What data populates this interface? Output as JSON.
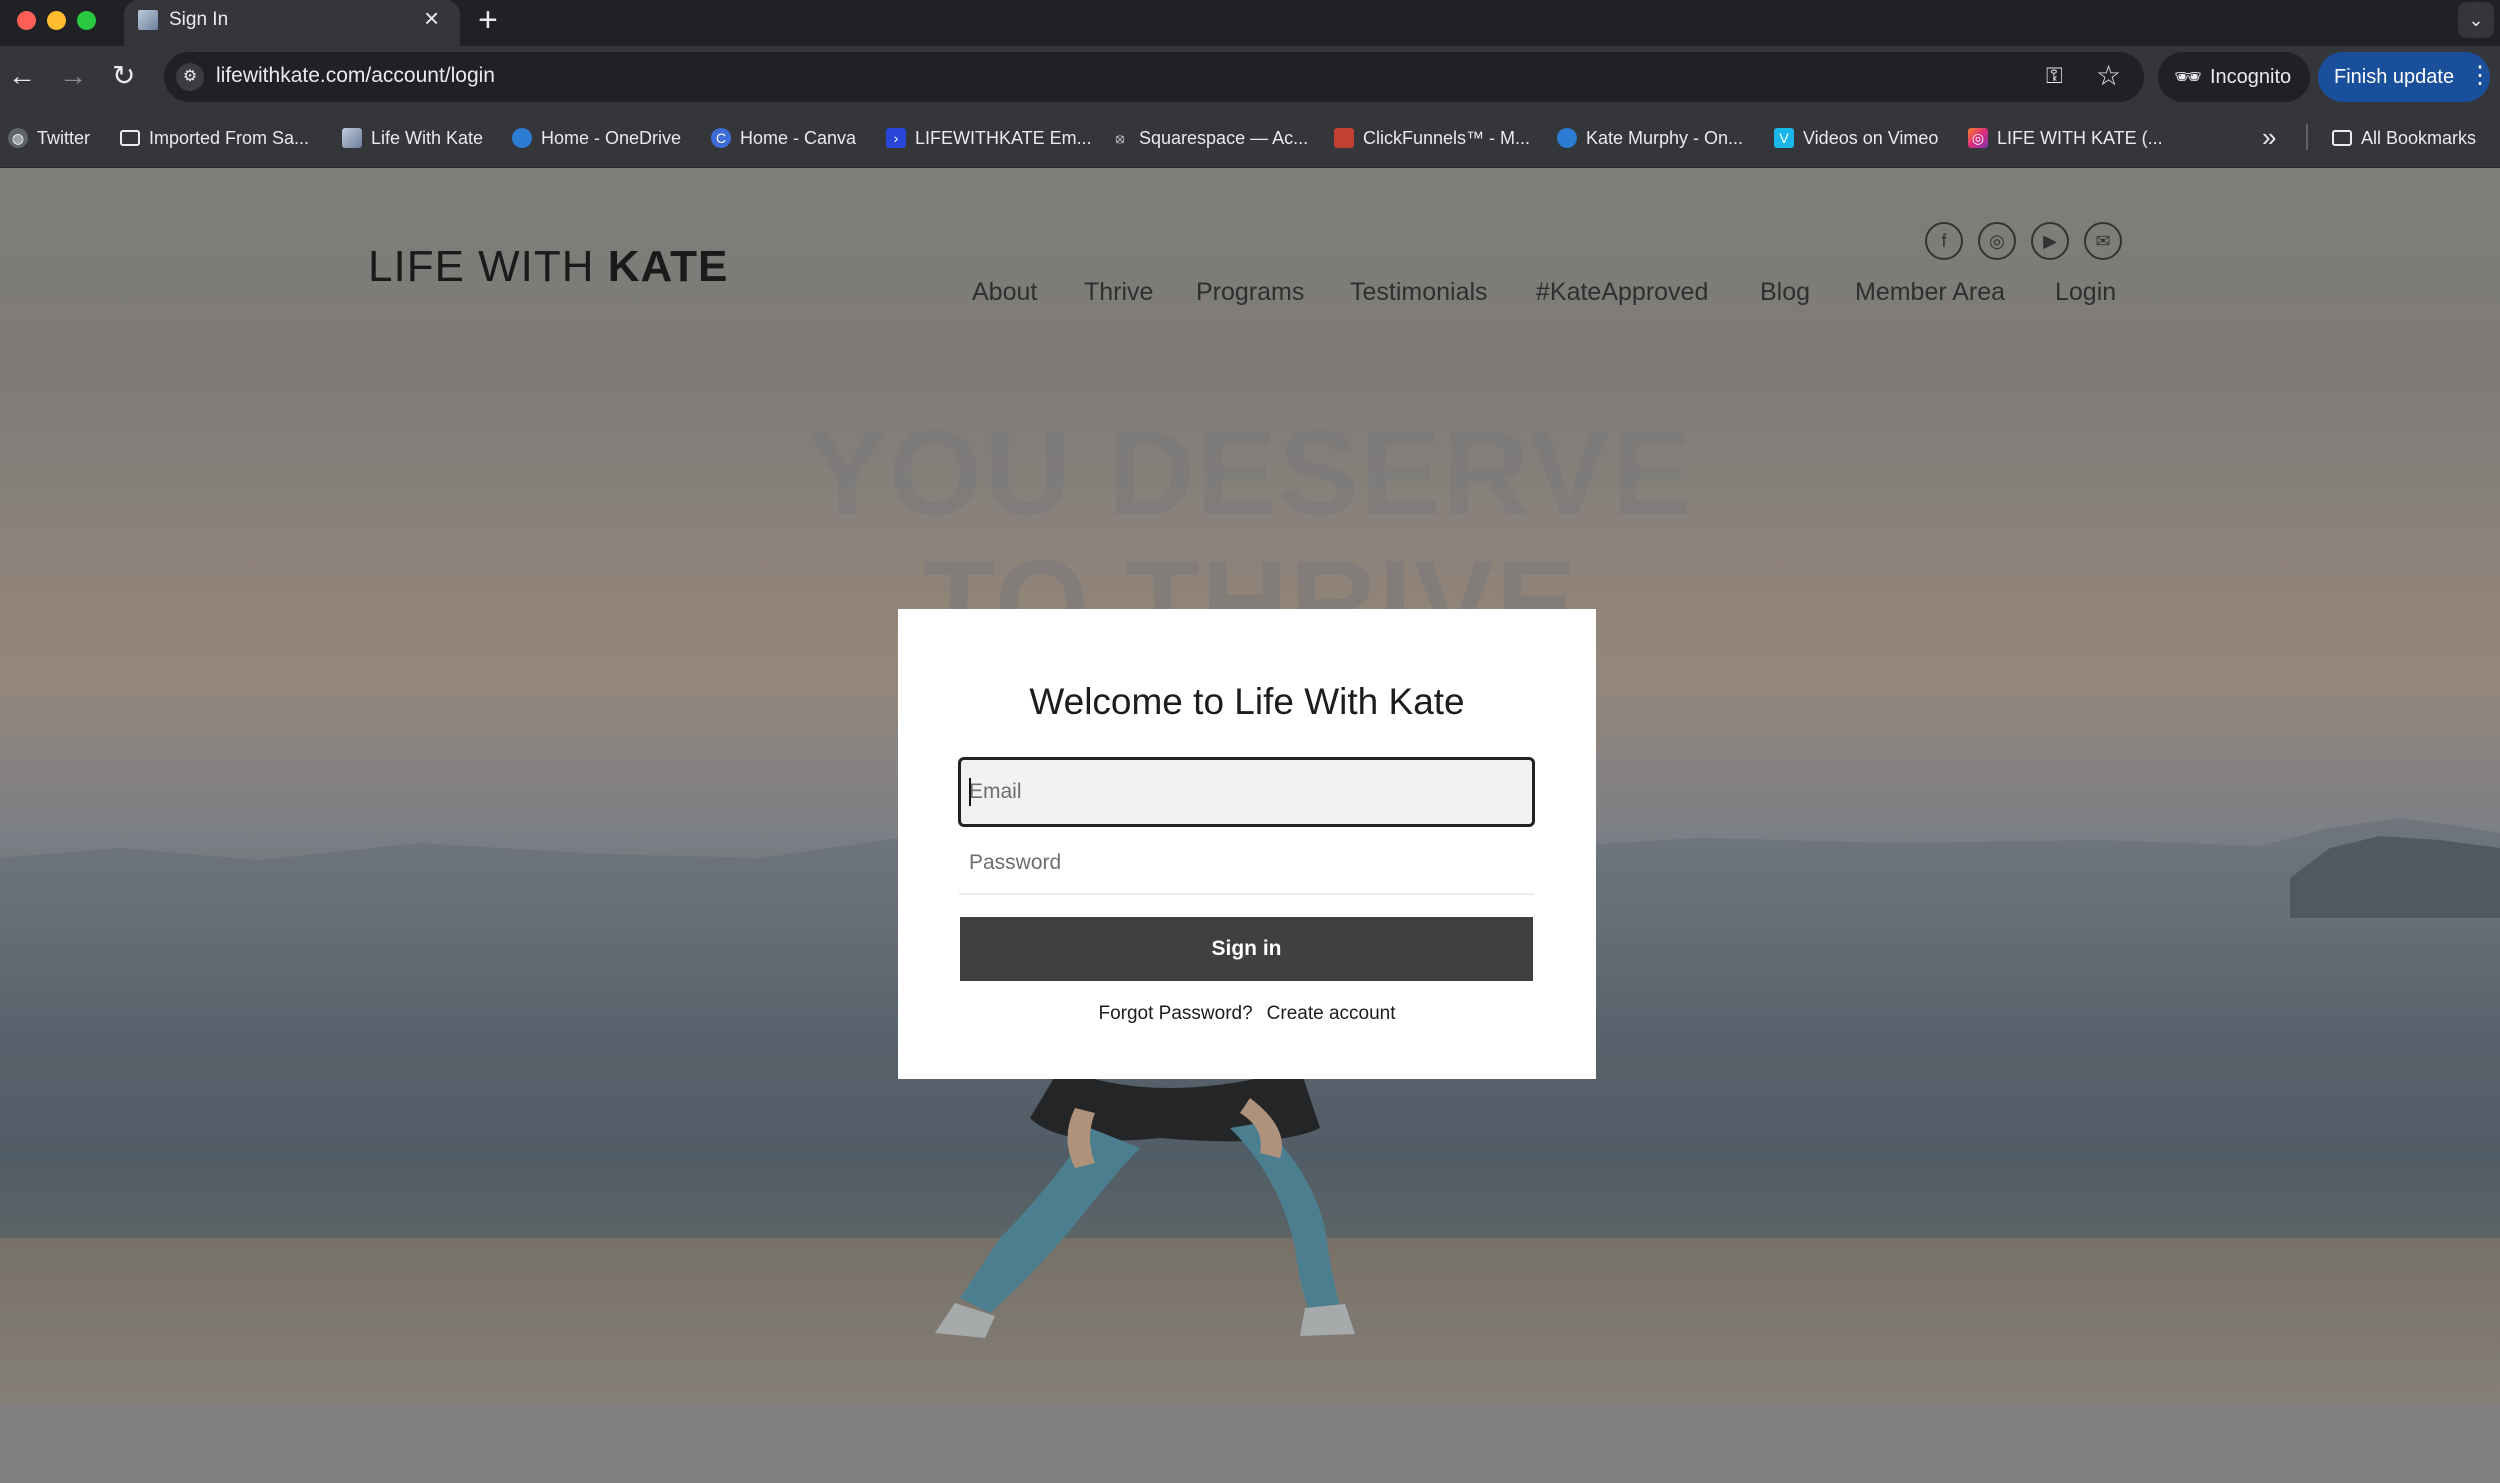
{
  "browser": {
    "tab": {
      "title": "Sign In",
      "close": "×"
    },
    "new_tab": "+",
    "tab_search": "⌄",
    "url": "lifewithkate.com/account/login",
    "incognito_label": "Incognito",
    "finish_update_label": "Finish update",
    "bookmarks": [
      {
        "label": "Twitter",
        "icon": "globe-icon"
      },
      {
        "label": "Imported From Sa...",
        "icon": "folder-icon"
      },
      {
        "label": "Life With Kate",
        "icon": "site-favicon"
      },
      {
        "label": "Home - OneDrive",
        "icon": "onedrive-icon"
      },
      {
        "label": "Home - Canva",
        "icon": "canva-icon"
      },
      {
        "label": "LIFEWITHKATE Em...",
        "icon": "arrow-favicon"
      },
      {
        "label": "Squarespace — Ac...",
        "icon": "squarespace-icon"
      },
      {
        "label": "ClickFunnels™ - M...",
        "icon": "clickfunnels-icon"
      },
      {
        "label": "Kate Murphy - On...",
        "icon": "onedrive-icon"
      },
      {
        "label": "Videos on Vimeo",
        "icon": "vimeo-icon"
      },
      {
        "label": "LIFE WITH KATE (...",
        "icon": "instagram-icon"
      }
    ],
    "all_bookmarks": "All Bookmarks"
  },
  "site": {
    "logo_light": "LIFE WITH ",
    "logo_bold": "KATE",
    "nav": [
      "About",
      "Thrive",
      "Programs",
      "Testimonials",
      "#KateApproved",
      "Blog",
      "Member Area",
      "Login"
    ],
    "social": [
      "facebook-icon",
      "instagram-icon",
      "youtube-icon",
      "email-icon"
    ],
    "hero_line1": "YOU DESERVE",
    "hero_line2": "TO THRIVE"
  },
  "dialog": {
    "title": "Welcome to Life With Kate",
    "email_placeholder": "Email",
    "password_placeholder": "Password",
    "signin_label": "Sign in",
    "forgot_label": "Forgot Password?",
    "create_label": "Create account"
  },
  "colors": {
    "dialog_button": "#404040",
    "chrome_bg": "#35363a",
    "finish_update": "#1a4f9c"
  }
}
